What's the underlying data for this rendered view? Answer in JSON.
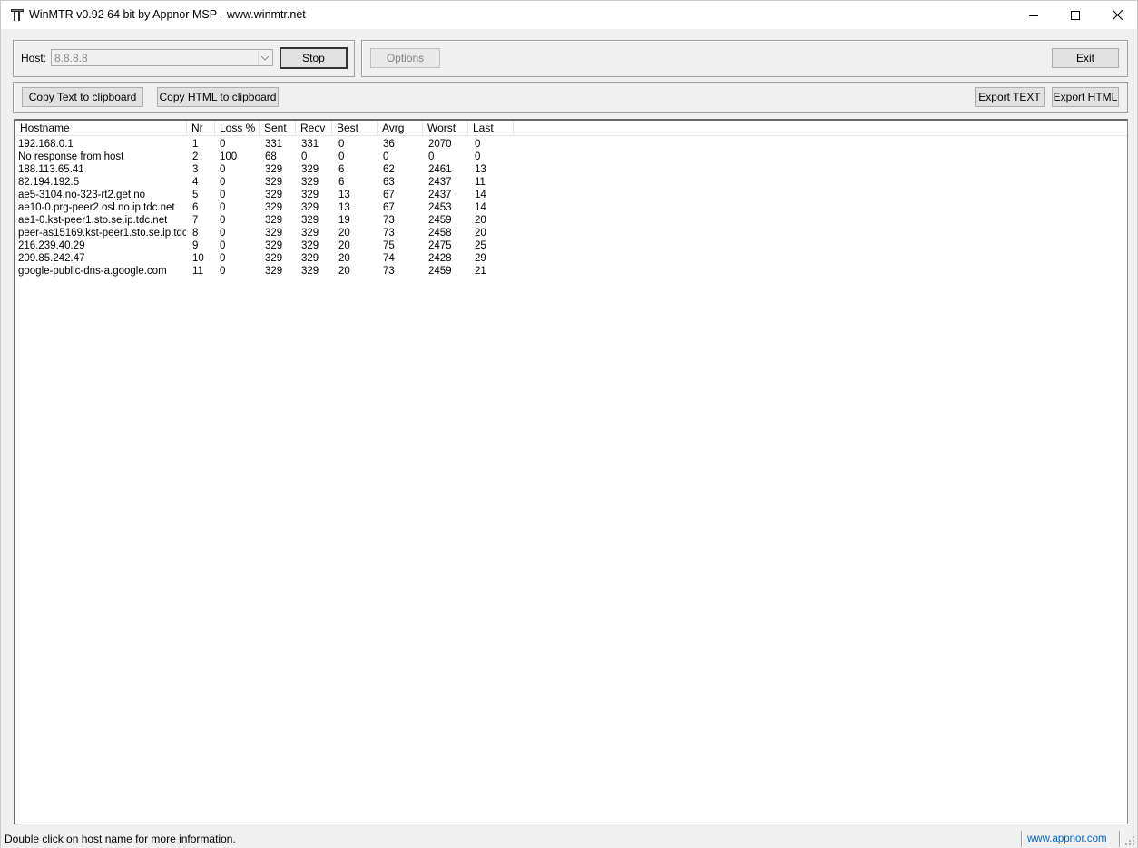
{
  "window": {
    "title": "WinMTR v0.92 64 bit by Appnor MSP - www.winmtr.net",
    "icons": [
      "app-icon",
      "minimize-icon",
      "maximize-icon",
      "close-icon"
    ]
  },
  "toolbar": {
    "host_label": "Host:",
    "host_value": "8.8.8.8",
    "stop_label": "Stop",
    "options_label": "Options",
    "exit_label": "Exit",
    "copy_text_label": "Copy Text to clipboard",
    "copy_html_label": "Copy HTML to clipboard",
    "export_text_label": "Export TEXT",
    "export_html_label": "Export HTML"
  },
  "table": {
    "columns": [
      "Hostname",
      "Nr",
      "Loss %",
      "Sent",
      "Recv",
      "Best",
      "Avrg",
      "Worst",
      "Last"
    ],
    "rows": [
      [
        "192.168.0.1",
        "1",
        "0",
        "331",
        "331",
        "0",
        "36",
        "2070",
        "0"
      ],
      [
        "No response from host",
        "2",
        "100",
        "68",
        "0",
        "0",
        "0",
        "0",
        "0"
      ],
      [
        "188.113.65.41",
        "3",
        "0",
        "329",
        "329",
        "6",
        "62",
        "2461",
        "13"
      ],
      [
        "82.194.192.5",
        "4",
        "0",
        "329",
        "329",
        "6",
        "63",
        "2437",
        "11"
      ],
      [
        "ae5-3104.no-323-rt2.get.no",
        "5",
        "0",
        "329",
        "329",
        "13",
        "67",
        "2437",
        "14"
      ],
      [
        "ae10-0.prg-peer2.osl.no.ip.tdc.net",
        "6",
        "0",
        "329",
        "329",
        "13",
        "67",
        "2453",
        "14"
      ],
      [
        "ae1-0.kst-peer1.sto.se.ip.tdc.net",
        "7",
        "0",
        "329",
        "329",
        "19",
        "73",
        "2459",
        "20"
      ],
      [
        "peer-as15169.kst-peer1.sto.se.ip.tdc....",
        "8",
        "0",
        "329",
        "329",
        "20",
        "73",
        "2458",
        "20"
      ],
      [
        "216.239.40.29",
        "9",
        "0",
        "329",
        "329",
        "20",
        "75",
        "2475",
        "25"
      ],
      [
        "209.85.242.47",
        "10",
        "0",
        "329",
        "329",
        "20",
        "74",
        "2428",
        "29"
      ],
      [
        "google-public-dns-a.google.com",
        "11",
        "0",
        "329",
        "329",
        "20",
        "73",
        "2459",
        "21"
      ]
    ]
  },
  "statusbar": {
    "text": "Double click on host name for more information.",
    "link": "www.appnor.com"
  },
  "colors": {
    "link": "#0066cc",
    "window_bg": "#f0f0f0"
  }
}
